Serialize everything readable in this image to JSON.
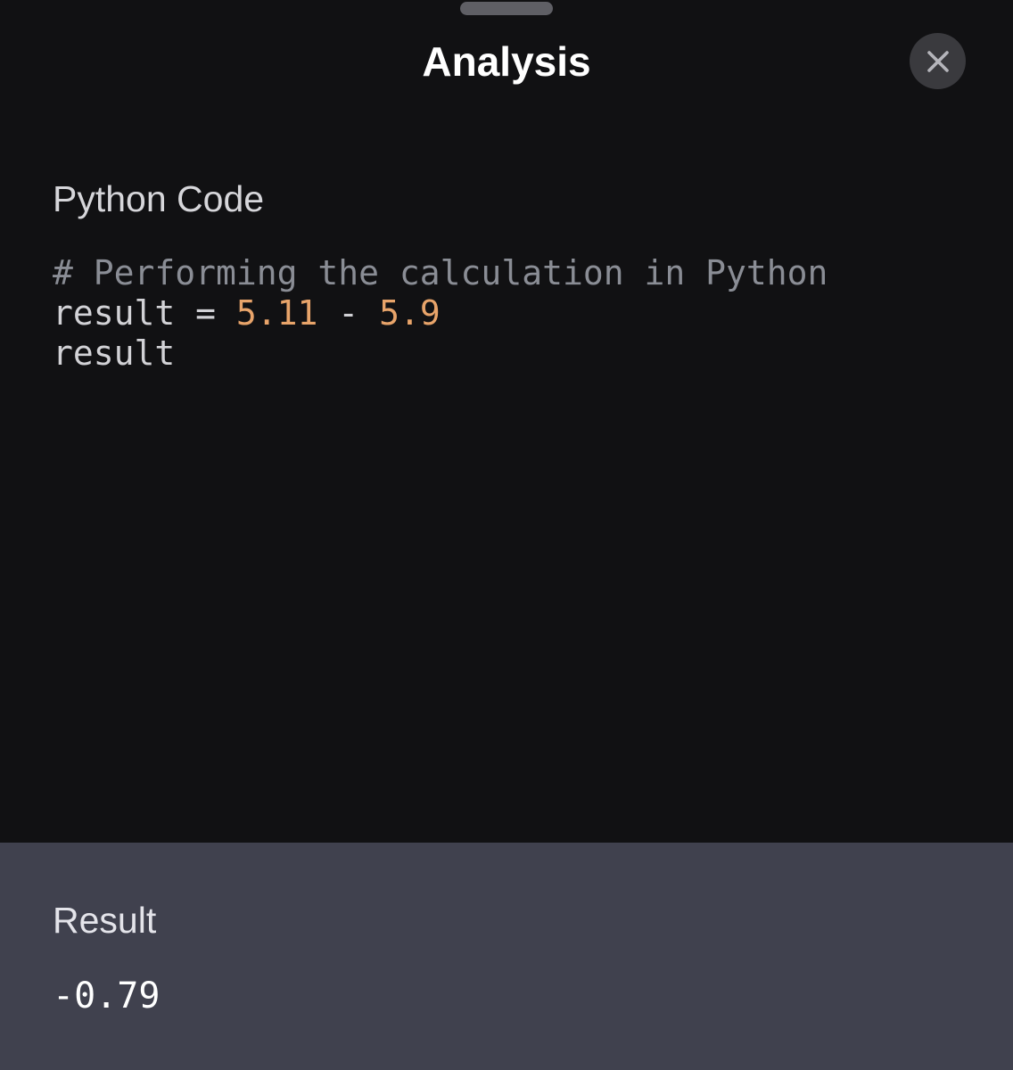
{
  "header": {
    "title": "Analysis",
    "close_icon": "close-icon"
  },
  "code_section": {
    "label": "Python Code",
    "lines": [
      [
        {
          "type": "comment",
          "text": "# Performing the calculation in Python"
        }
      ],
      [
        {
          "type": "plain",
          "text": "result = "
        },
        {
          "type": "number",
          "text": "5.11"
        },
        {
          "type": "plain",
          "text": " - "
        },
        {
          "type": "number",
          "text": "5.9"
        }
      ],
      [
        {
          "type": "plain",
          "text": "result"
        }
      ]
    ]
  },
  "result_section": {
    "label": "Result",
    "value": "-0.79"
  },
  "colors": {
    "background": "#111113",
    "result_panel": "#40414e",
    "number_token": "#e8a46a",
    "comment_token": "#8a8d95"
  }
}
